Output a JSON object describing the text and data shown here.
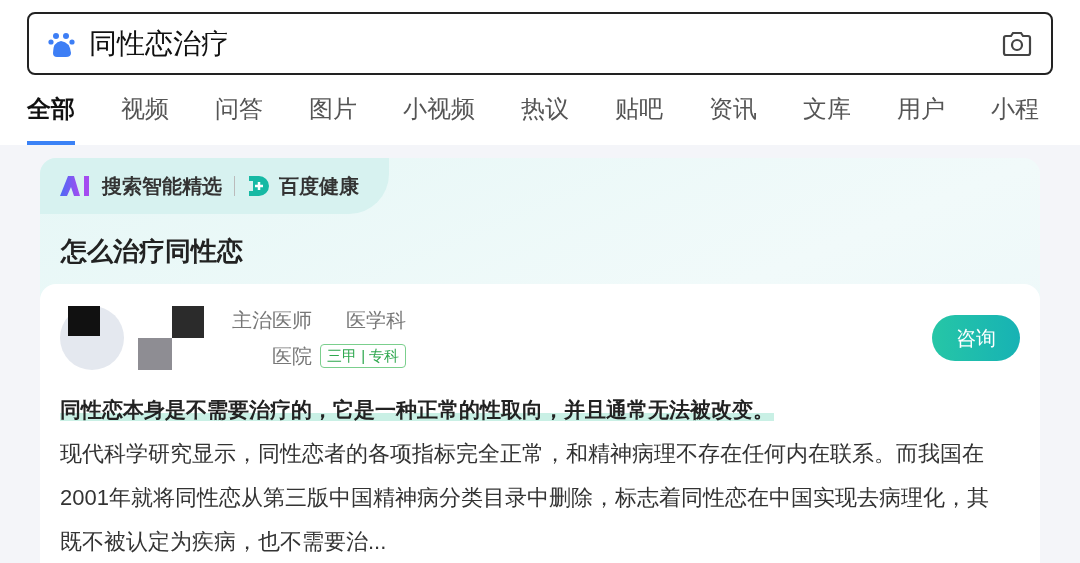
{
  "search": {
    "value": "同性恋治疗"
  },
  "tabs": [
    {
      "label": "全部",
      "selected": true
    },
    {
      "label": "视频",
      "selected": false
    },
    {
      "label": "问答",
      "selected": false
    },
    {
      "label": "图片",
      "selected": false
    },
    {
      "label": "小视频",
      "selected": false
    },
    {
      "label": "热议",
      "selected": false
    },
    {
      "label": "贴吧",
      "selected": false
    },
    {
      "label": "资讯",
      "selected": false
    },
    {
      "label": "文库",
      "selected": false
    },
    {
      "label": "用户",
      "selected": false
    },
    {
      "label": "小程",
      "selected": false
    }
  ],
  "card": {
    "source_label": "搜索智能精选",
    "partner": "百度健康",
    "question": "怎么治疗同性恋",
    "doctor": {
      "title": "主治医师",
      "department": "医学科",
      "hospital": "医院",
      "badge": "三甲 | 专科"
    },
    "consult_button": "咨询",
    "highlight": "同性恋本身是不需要治疗的，它是一种正常的性取向，并且通常无法被改变。",
    "body": "现代科学研究显示，同性恋者的各项指标完全正常，和精神病理不存在任何内在联系。而我国在2001年就将同性恋从第三版中国精神病分类目录中删除，标志着同性恋在中国实现去病理化，其既不被认定为疾病，也不需要治..."
  }
}
